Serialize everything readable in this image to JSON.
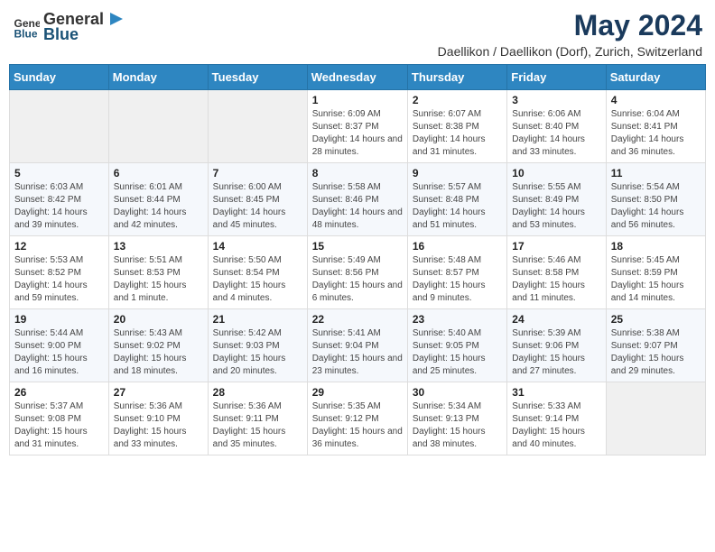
{
  "header": {
    "logo_general": "General",
    "logo_blue": "Blue",
    "title": "May 2024",
    "location": "Daellikon / Daellikon (Dorf), Zurich, Switzerland"
  },
  "days_of_week": [
    "Sunday",
    "Monday",
    "Tuesday",
    "Wednesday",
    "Thursday",
    "Friday",
    "Saturday"
  ],
  "weeks": [
    {
      "days": [
        {
          "number": "",
          "sunrise": "",
          "sunset": "",
          "daylight": "",
          "empty": true
        },
        {
          "number": "",
          "sunrise": "",
          "sunset": "",
          "daylight": "",
          "empty": true
        },
        {
          "number": "",
          "sunrise": "",
          "sunset": "",
          "daylight": "",
          "empty": true
        },
        {
          "number": "1",
          "sunrise": "Sunrise: 6:09 AM",
          "sunset": "Sunset: 8:37 PM",
          "daylight": "Daylight: 14 hours and 28 minutes."
        },
        {
          "number": "2",
          "sunrise": "Sunrise: 6:07 AM",
          "sunset": "Sunset: 8:38 PM",
          "daylight": "Daylight: 14 hours and 31 minutes."
        },
        {
          "number": "3",
          "sunrise": "Sunrise: 6:06 AM",
          "sunset": "Sunset: 8:40 PM",
          "daylight": "Daylight: 14 hours and 33 minutes."
        },
        {
          "number": "4",
          "sunrise": "Sunrise: 6:04 AM",
          "sunset": "Sunset: 8:41 PM",
          "daylight": "Daylight: 14 hours and 36 minutes."
        }
      ]
    },
    {
      "days": [
        {
          "number": "5",
          "sunrise": "Sunrise: 6:03 AM",
          "sunset": "Sunset: 8:42 PM",
          "daylight": "Daylight: 14 hours and 39 minutes."
        },
        {
          "number": "6",
          "sunrise": "Sunrise: 6:01 AM",
          "sunset": "Sunset: 8:44 PM",
          "daylight": "Daylight: 14 hours and 42 minutes."
        },
        {
          "number": "7",
          "sunrise": "Sunrise: 6:00 AM",
          "sunset": "Sunset: 8:45 PM",
          "daylight": "Daylight: 14 hours and 45 minutes."
        },
        {
          "number": "8",
          "sunrise": "Sunrise: 5:58 AM",
          "sunset": "Sunset: 8:46 PM",
          "daylight": "Daylight: 14 hours and 48 minutes."
        },
        {
          "number": "9",
          "sunrise": "Sunrise: 5:57 AM",
          "sunset": "Sunset: 8:48 PM",
          "daylight": "Daylight: 14 hours and 51 minutes."
        },
        {
          "number": "10",
          "sunrise": "Sunrise: 5:55 AM",
          "sunset": "Sunset: 8:49 PM",
          "daylight": "Daylight: 14 hours and 53 minutes."
        },
        {
          "number": "11",
          "sunrise": "Sunrise: 5:54 AM",
          "sunset": "Sunset: 8:50 PM",
          "daylight": "Daylight: 14 hours and 56 minutes."
        }
      ]
    },
    {
      "days": [
        {
          "number": "12",
          "sunrise": "Sunrise: 5:53 AM",
          "sunset": "Sunset: 8:52 PM",
          "daylight": "Daylight: 14 hours and 59 minutes."
        },
        {
          "number": "13",
          "sunrise": "Sunrise: 5:51 AM",
          "sunset": "Sunset: 8:53 PM",
          "daylight": "Daylight: 15 hours and 1 minute."
        },
        {
          "number": "14",
          "sunrise": "Sunrise: 5:50 AM",
          "sunset": "Sunset: 8:54 PM",
          "daylight": "Daylight: 15 hours and 4 minutes."
        },
        {
          "number": "15",
          "sunrise": "Sunrise: 5:49 AM",
          "sunset": "Sunset: 8:56 PM",
          "daylight": "Daylight: 15 hours and 6 minutes."
        },
        {
          "number": "16",
          "sunrise": "Sunrise: 5:48 AM",
          "sunset": "Sunset: 8:57 PM",
          "daylight": "Daylight: 15 hours and 9 minutes."
        },
        {
          "number": "17",
          "sunrise": "Sunrise: 5:46 AM",
          "sunset": "Sunset: 8:58 PM",
          "daylight": "Daylight: 15 hours and 11 minutes."
        },
        {
          "number": "18",
          "sunrise": "Sunrise: 5:45 AM",
          "sunset": "Sunset: 8:59 PM",
          "daylight": "Daylight: 15 hours and 14 minutes."
        }
      ]
    },
    {
      "days": [
        {
          "number": "19",
          "sunrise": "Sunrise: 5:44 AM",
          "sunset": "Sunset: 9:00 PM",
          "daylight": "Daylight: 15 hours and 16 minutes."
        },
        {
          "number": "20",
          "sunrise": "Sunrise: 5:43 AM",
          "sunset": "Sunset: 9:02 PM",
          "daylight": "Daylight: 15 hours and 18 minutes."
        },
        {
          "number": "21",
          "sunrise": "Sunrise: 5:42 AM",
          "sunset": "Sunset: 9:03 PM",
          "daylight": "Daylight: 15 hours and 20 minutes."
        },
        {
          "number": "22",
          "sunrise": "Sunrise: 5:41 AM",
          "sunset": "Sunset: 9:04 PM",
          "daylight": "Daylight: 15 hours and 23 minutes."
        },
        {
          "number": "23",
          "sunrise": "Sunrise: 5:40 AM",
          "sunset": "Sunset: 9:05 PM",
          "daylight": "Daylight: 15 hours and 25 minutes."
        },
        {
          "number": "24",
          "sunrise": "Sunrise: 5:39 AM",
          "sunset": "Sunset: 9:06 PM",
          "daylight": "Daylight: 15 hours and 27 minutes."
        },
        {
          "number": "25",
          "sunrise": "Sunrise: 5:38 AM",
          "sunset": "Sunset: 9:07 PM",
          "daylight": "Daylight: 15 hours and 29 minutes."
        }
      ]
    },
    {
      "days": [
        {
          "number": "26",
          "sunrise": "Sunrise: 5:37 AM",
          "sunset": "Sunset: 9:08 PM",
          "daylight": "Daylight: 15 hours and 31 minutes."
        },
        {
          "number": "27",
          "sunrise": "Sunrise: 5:36 AM",
          "sunset": "Sunset: 9:10 PM",
          "daylight": "Daylight: 15 hours and 33 minutes."
        },
        {
          "number": "28",
          "sunrise": "Sunrise: 5:36 AM",
          "sunset": "Sunset: 9:11 PM",
          "daylight": "Daylight: 15 hours and 35 minutes."
        },
        {
          "number": "29",
          "sunrise": "Sunrise: 5:35 AM",
          "sunset": "Sunset: 9:12 PM",
          "daylight": "Daylight: 15 hours and 36 minutes."
        },
        {
          "number": "30",
          "sunrise": "Sunrise: 5:34 AM",
          "sunset": "Sunset: 9:13 PM",
          "daylight": "Daylight: 15 hours and 38 minutes."
        },
        {
          "number": "31",
          "sunrise": "Sunrise: 5:33 AM",
          "sunset": "Sunset: 9:14 PM",
          "daylight": "Daylight: 15 hours and 40 minutes."
        },
        {
          "number": "",
          "sunrise": "",
          "sunset": "",
          "daylight": "",
          "empty": true
        }
      ]
    }
  ]
}
